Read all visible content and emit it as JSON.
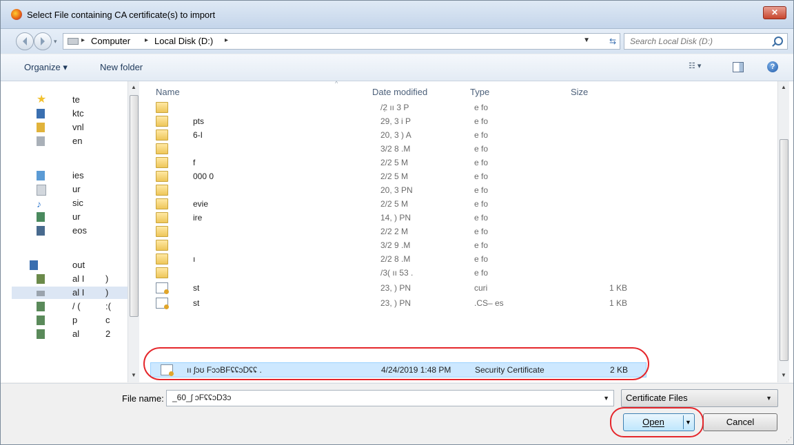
{
  "window": {
    "title": "Select File containing CA certificate(s) to import",
    "close_label": "✕"
  },
  "address": {
    "crumbs": [
      "Computer",
      "Local Disk (D:)"
    ],
    "search_placeholder": "Search Local Disk (D:)"
  },
  "toolbar": {
    "organize": "Organize ▾",
    "new_folder": "New folder",
    "view_label": "☷ ▾",
    "help": "?"
  },
  "nav": {
    "items": [
      {
        "label": "te",
        "icon": "star-icon",
        "color": "#f2c12e"
      },
      {
        "label": "ktc",
        "icon": "desktop-icon",
        "color": "#3a6fb0"
      },
      {
        "label": "vnl",
        "icon": "downloads-icon",
        "color": "#e1b33b"
      },
      {
        "label": "en",
        "icon": "recent-places-icon",
        "color": "#8c96a0"
      },
      {
        "label": "ies",
        "icon": "libraries-icon",
        "color": "#5b9bd5"
      },
      {
        "label": "ur",
        "icon": "documents-icon",
        "color": "#b0b8c2"
      },
      {
        "label": "sic",
        "icon": "music-icon",
        "color": "#3a7fd0"
      },
      {
        "label": "ur",
        "icon": "pictures-icon",
        "color": "#4a8a5e"
      },
      {
        "label": "eos",
        "icon": "videos-icon",
        "color": "#486a8e"
      },
      {
        "label": "out",
        "icon": "computer-icon",
        "color": "#3a6fb0"
      },
      {
        "label": "al I",
        "label2": ")",
        "icon": "drive-icon",
        "color": "#6b8a4a"
      },
      {
        "label": "al I",
        "label2": ")",
        "icon": "drive-icon",
        "color": "#9aa3ad"
      },
      {
        "label": "/ (",
        "label2": ":(",
        "icon": "network-drive-icon",
        "color": "#5a8a5a"
      },
      {
        "label": "p",
        "label2": "c",
        "icon": "network-drive-icon",
        "color": "#5a8a5a"
      },
      {
        "label": "al",
        "label2": "2",
        "icon": "network-drive-icon",
        "color": "#5a8a5a"
      }
    ]
  },
  "columns": {
    "name": "Name",
    "date": "Date modified",
    "type": "Type",
    "size": "Size"
  },
  "files": [
    {
      "name": "",
      "date": "/2̣   ıı    3 P",
      "type": "e fo",
      "size": "",
      "kind": "folder"
    },
    {
      "name": "pts",
      "date": "29,    3     i P",
      "type": "e fo",
      "size": "",
      "kind": "folder"
    },
    {
      "name": "6-I",
      "date": "20,    3     ) A",
      "type": "e fo",
      "size": "",
      "kind": "folder"
    },
    {
      "name": "",
      "date": "3/2    8    .M",
      "type": "e fo",
      "size": "",
      "kind": "folder"
    },
    {
      "name": "f",
      "date": "2/2    5     M",
      "type": "e fo",
      "size": "",
      "kind": "folder"
    },
    {
      "name": "000              0",
      "date": "2/2    5     M",
      "type": "e fo",
      "size": "",
      "kind": "folder"
    },
    {
      "name": "",
      "date": "20,    3    PN",
      "type": "e fo",
      "size": "",
      "kind": "folder"
    },
    {
      "name": "evie",
      "date": "2/2    5     M",
      "type": "e fo",
      "size": "",
      "kind": "folder"
    },
    {
      "name": "ire",
      "date": "14,    )     PN",
      "type": "e fo",
      "size": "",
      "kind": "folder"
    },
    {
      "name": "",
      "date": "2/2    2     M",
      "type": "e fo",
      "size": "",
      "kind": "folder"
    },
    {
      "name": "",
      "date": "3/2    9    .M",
      "type": "e fo",
      "size": "",
      "kind": "folder"
    },
    {
      "name": "ı",
      "date": "2/2    8    .M",
      "type": "e fo",
      "size": "",
      "kind": "folder"
    },
    {
      "name": "",
      "date": "/3(   ıı   53 .",
      "type": "e fo",
      "size": "",
      "kind": "folder"
    },
    {
      "name": "st",
      "date": "23,    )     PN",
      "type": "curi",
      "size": "1 KB",
      "kind": "cert"
    },
    {
      "name": "st",
      "date": "23,    )     PN",
      "type": ".CS–            es",
      "size": "1 KB",
      "kind": "cert"
    },
    {
      "name": "ıı ʃɔʊ FɔɔBFʢʢɔDʢʢ .",
      "date": "4/24/2019 1:48 PM",
      "type": "Security Certificate",
      "size": "2 KB",
      "kind": "cert",
      "selected": true
    }
  ],
  "bottom": {
    "file_name_label": "File name:",
    "file_name_value": "_60_ʃ  ɔFʢʢɔD3ɔ",
    "filter_value": "Certificate Files",
    "open_label": "Open",
    "cancel_label": "Cancel"
  },
  "colors": {
    "highlight": "#e5262b",
    "selection": "#cde8ff"
  }
}
